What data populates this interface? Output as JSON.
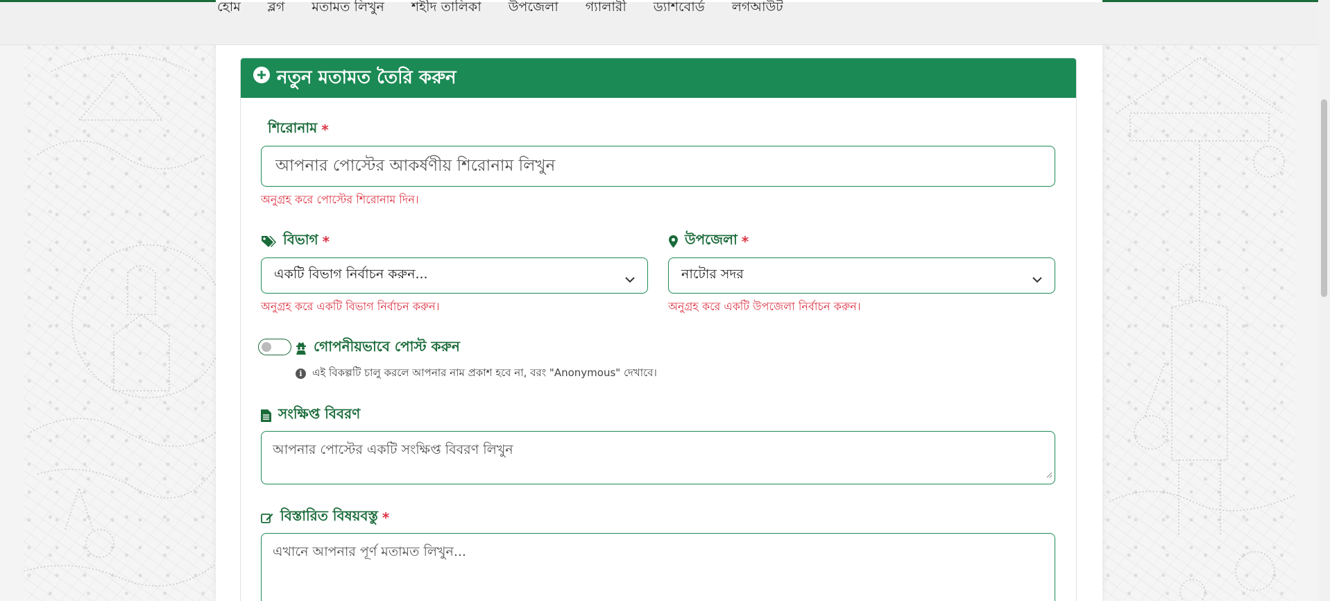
{
  "nav": {
    "items": [
      "হোম",
      "ব্লগ",
      "মতামত লিখুন",
      "শহীদ তালিকা",
      "উপজেলা",
      "গ্যালারী",
      "ড্যাশবোর্ড",
      "লগআউট"
    ]
  },
  "form": {
    "header_title": "নতুন মতামত তৈরি করুন",
    "required_mark": "*",
    "title_label": "শিরোনাম",
    "title_placeholder": "আপনার পোস্টের আকর্ষণীয় শিরোনাম লিখুন",
    "title_error": "অনুগ্রহ করে পোস্টের শিরোনাম দিন।",
    "category_label": "বিভাগ",
    "category_value": "একটি বিভাগ নির্বাচন করুন...",
    "category_error": "অনুগ্রহ করে একটি বিভাগ নির্বাচন করুন।",
    "upazila_label": "উপজেলা",
    "upazila_value": "নাটোর সদর",
    "upazila_error": "অনুগ্রহ করে একটি উপজেলা নির্বাচন করুন।",
    "anonymous_label": "গোপনীয়ভাবে পোস্ট করুন",
    "anonymous_enabled": false,
    "anonymous_hint": "এই বিকল্পটি চালু করলে আপনার নাম প্রকাশ হবে না, বরং \"Anonymous\" দেখাবে।",
    "summary_label": "সংক্ষিপ্ত বিবরণ",
    "summary_placeholder": "আপনার পোস্টের একটি সংক্ষিপ্ত বিবরণ লিখুন",
    "content_label": "বিস্তারিত বিষয়বস্তু",
    "content_placeholder": "এখানে আপনার পূর্ণ মতামত লিখুন..."
  },
  "colors": {
    "brand_green": "#1b8a55",
    "label_green": "#1b6b3a",
    "error_red": "#dc3545"
  },
  "icons": [
    "plus-circle-icon",
    "tags-icon",
    "map-marker-icon",
    "user-secret-icon",
    "info-circle-icon",
    "file-text-icon",
    "edit-icon",
    "chevron-down-icon"
  ]
}
